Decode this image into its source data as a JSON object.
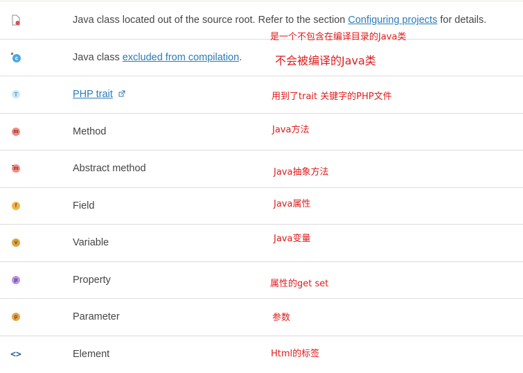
{
  "rows": [
    {
      "icon": "java-class-outside-source-root-icon",
      "desc_prefix": "Java class located out of the source root. Refer to the section ",
      "desc_link": "Configuring projects",
      "desc_suffix": " for details.",
      "annotation": "是一个不包含在编译目录的Java类"
    },
    {
      "icon": "java-class-excluded-icon",
      "desc_prefix": "Java class ",
      "desc_link": "excluded from compilation",
      "desc_suffix": ".",
      "annotation": "不会被编译的Java类"
    },
    {
      "icon": "php-trait-icon",
      "desc_link": "PHP trait",
      "annotation": "用到了trait 关键字的PHP文件"
    },
    {
      "icon": "method-icon",
      "desc": "Method",
      "annotation": "Java方法"
    },
    {
      "icon": "abstract-method-icon",
      "desc": "Abstract method",
      "annotation": "Java抽象方法"
    },
    {
      "icon": "field-icon",
      "desc": "Field",
      "annotation": "Java属性"
    },
    {
      "icon": "variable-icon",
      "desc": "Variable",
      "annotation": "Java变量"
    },
    {
      "icon": "property-icon",
      "desc": "Property",
      "annotation": "属性的get set"
    },
    {
      "icon": "parameter-icon",
      "desc": "Parameter",
      "annotation": "参数"
    },
    {
      "icon": "element-icon",
      "desc": "Element",
      "annotation": "Html的标签"
    }
  ],
  "icon_letters": {
    "java_class": "c",
    "php_trait": "T",
    "method": "m",
    "abstract_method": "m",
    "field": "f",
    "variable": "v",
    "property": "p",
    "parameter": "p",
    "element": "<>"
  },
  "colors": {
    "link": "#2a7ab8",
    "annotation": "#e11a1a",
    "text": "#454545",
    "divider": "#dcdcdc",
    "method": "#f08d86",
    "field": "#f0b44f",
    "variable": "#d8a640",
    "property": "#b995e6",
    "parameter": "#e7a64b",
    "class": "#4aa7e0",
    "trait": "#5aa9d4"
  }
}
